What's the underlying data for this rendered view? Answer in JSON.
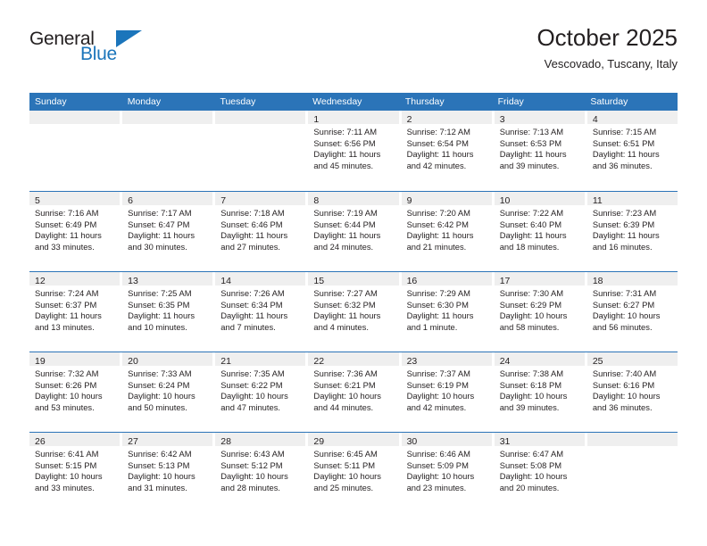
{
  "brand": {
    "name_part1": "General",
    "name_part2": "Blue",
    "accent_color": "#1b75bb"
  },
  "header": {
    "title": "October 2025",
    "subtitle": "Vescovado, Tuscany, Italy"
  },
  "calendar": {
    "header_color": "#2b74b8",
    "daynum_band_color": "#efefef",
    "weekdays": [
      "Sunday",
      "Monday",
      "Tuesday",
      "Wednesday",
      "Thursday",
      "Friday",
      "Saturday"
    ],
    "weeks": [
      [
        {
          "day": "",
          "lines": []
        },
        {
          "day": "",
          "lines": []
        },
        {
          "day": "",
          "lines": []
        },
        {
          "day": "1",
          "lines": [
            "Sunrise: 7:11 AM",
            "Sunset: 6:56 PM",
            "Daylight: 11 hours",
            "and 45 minutes."
          ]
        },
        {
          "day": "2",
          "lines": [
            "Sunrise: 7:12 AM",
            "Sunset: 6:54 PM",
            "Daylight: 11 hours",
            "and 42 minutes."
          ]
        },
        {
          "day": "3",
          "lines": [
            "Sunrise: 7:13 AM",
            "Sunset: 6:53 PM",
            "Daylight: 11 hours",
            "and 39 minutes."
          ]
        },
        {
          "day": "4",
          "lines": [
            "Sunrise: 7:15 AM",
            "Sunset: 6:51 PM",
            "Daylight: 11 hours",
            "and 36 minutes."
          ]
        }
      ],
      [
        {
          "day": "5",
          "lines": [
            "Sunrise: 7:16 AM",
            "Sunset: 6:49 PM",
            "Daylight: 11 hours",
            "and 33 minutes."
          ]
        },
        {
          "day": "6",
          "lines": [
            "Sunrise: 7:17 AM",
            "Sunset: 6:47 PM",
            "Daylight: 11 hours",
            "and 30 minutes."
          ]
        },
        {
          "day": "7",
          "lines": [
            "Sunrise: 7:18 AM",
            "Sunset: 6:46 PM",
            "Daylight: 11 hours",
            "and 27 minutes."
          ]
        },
        {
          "day": "8",
          "lines": [
            "Sunrise: 7:19 AM",
            "Sunset: 6:44 PM",
            "Daylight: 11 hours",
            "and 24 minutes."
          ]
        },
        {
          "day": "9",
          "lines": [
            "Sunrise: 7:20 AM",
            "Sunset: 6:42 PM",
            "Daylight: 11 hours",
            "and 21 minutes."
          ]
        },
        {
          "day": "10",
          "lines": [
            "Sunrise: 7:22 AM",
            "Sunset: 6:40 PM",
            "Daylight: 11 hours",
            "and 18 minutes."
          ]
        },
        {
          "day": "11",
          "lines": [
            "Sunrise: 7:23 AM",
            "Sunset: 6:39 PM",
            "Daylight: 11 hours",
            "and 16 minutes."
          ]
        }
      ],
      [
        {
          "day": "12",
          "lines": [
            "Sunrise: 7:24 AM",
            "Sunset: 6:37 PM",
            "Daylight: 11 hours",
            "and 13 minutes."
          ]
        },
        {
          "day": "13",
          "lines": [
            "Sunrise: 7:25 AM",
            "Sunset: 6:35 PM",
            "Daylight: 11 hours",
            "and 10 minutes."
          ]
        },
        {
          "day": "14",
          "lines": [
            "Sunrise: 7:26 AM",
            "Sunset: 6:34 PM",
            "Daylight: 11 hours",
            "and 7 minutes."
          ]
        },
        {
          "day": "15",
          "lines": [
            "Sunrise: 7:27 AM",
            "Sunset: 6:32 PM",
            "Daylight: 11 hours",
            "and 4 minutes."
          ]
        },
        {
          "day": "16",
          "lines": [
            "Sunrise: 7:29 AM",
            "Sunset: 6:30 PM",
            "Daylight: 11 hours",
            "and 1 minute."
          ]
        },
        {
          "day": "17",
          "lines": [
            "Sunrise: 7:30 AM",
            "Sunset: 6:29 PM",
            "Daylight: 10 hours",
            "and 58 minutes."
          ]
        },
        {
          "day": "18",
          "lines": [
            "Sunrise: 7:31 AM",
            "Sunset: 6:27 PM",
            "Daylight: 10 hours",
            "and 56 minutes."
          ]
        }
      ],
      [
        {
          "day": "19",
          "lines": [
            "Sunrise: 7:32 AM",
            "Sunset: 6:26 PM",
            "Daylight: 10 hours",
            "and 53 minutes."
          ]
        },
        {
          "day": "20",
          "lines": [
            "Sunrise: 7:33 AM",
            "Sunset: 6:24 PM",
            "Daylight: 10 hours",
            "and 50 minutes."
          ]
        },
        {
          "day": "21",
          "lines": [
            "Sunrise: 7:35 AM",
            "Sunset: 6:22 PM",
            "Daylight: 10 hours",
            "and 47 minutes."
          ]
        },
        {
          "day": "22",
          "lines": [
            "Sunrise: 7:36 AM",
            "Sunset: 6:21 PM",
            "Daylight: 10 hours",
            "and 44 minutes."
          ]
        },
        {
          "day": "23",
          "lines": [
            "Sunrise: 7:37 AM",
            "Sunset: 6:19 PM",
            "Daylight: 10 hours",
            "and 42 minutes."
          ]
        },
        {
          "day": "24",
          "lines": [
            "Sunrise: 7:38 AM",
            "Sunset: 6:18 PM",
            "Daylight: 10 hours",
            "and 39 minutes."
          ]
        },
        {
          "day": "25",
          "lines": [
            "Sunrise: 7:40 AM",
            "Sunset: 6:16 PM",
            "Daylight: 10 hours",
            "and 36 minutes."
          ]
        }
      ],
      [
        {
          "day": "26",
          "lines": [
            "Sunrise: 6:41 AM",
            "Sunset: 5:15 PM",
            "Daylight: 10 hours",
            "and 33 minutes."
          ]
        },
        {
          "day": "27",
          "lines": [
            "Sunrise: 6:42 AM",
            "Sunset: 5:13 PM",
            "Daylight: 10 hours",
            "and 31 minutes."
          ]
        },
        {
          "day": "28",
          "lines": [
            "Sunrise: 6:43 AM",
            "Sunset: 5:12 PM",
            "Daylight: 10 hours",
            "and 28 minutes."
          ]
        },
        {
          "day": "29",
          "lines": [
            "Sunrise: 6:45 AM",
            "Sunset: 5:11 PM",
            "Daylight: 10 hours",
            "and 25 minutes."
          ]
        },
        {
          "day": "30",
          "lines": [
            "Sunrise: 6:46 AM",
            "Sunset: 5:09 PM",
            "Daylight: 10 hours",
            "and 23 minutes."
          ]
        },
        {
          "day": "31",
          "lines": [
            "Sunrise: 6:47 AM",
            "Sunset: 5:08 PM",
            "Daylight: 10 hours",
            "and 20 minutes."
          ]
        },
        {
          "day": "",
          "lines": []
        }
      ]
    ]
  }
}
